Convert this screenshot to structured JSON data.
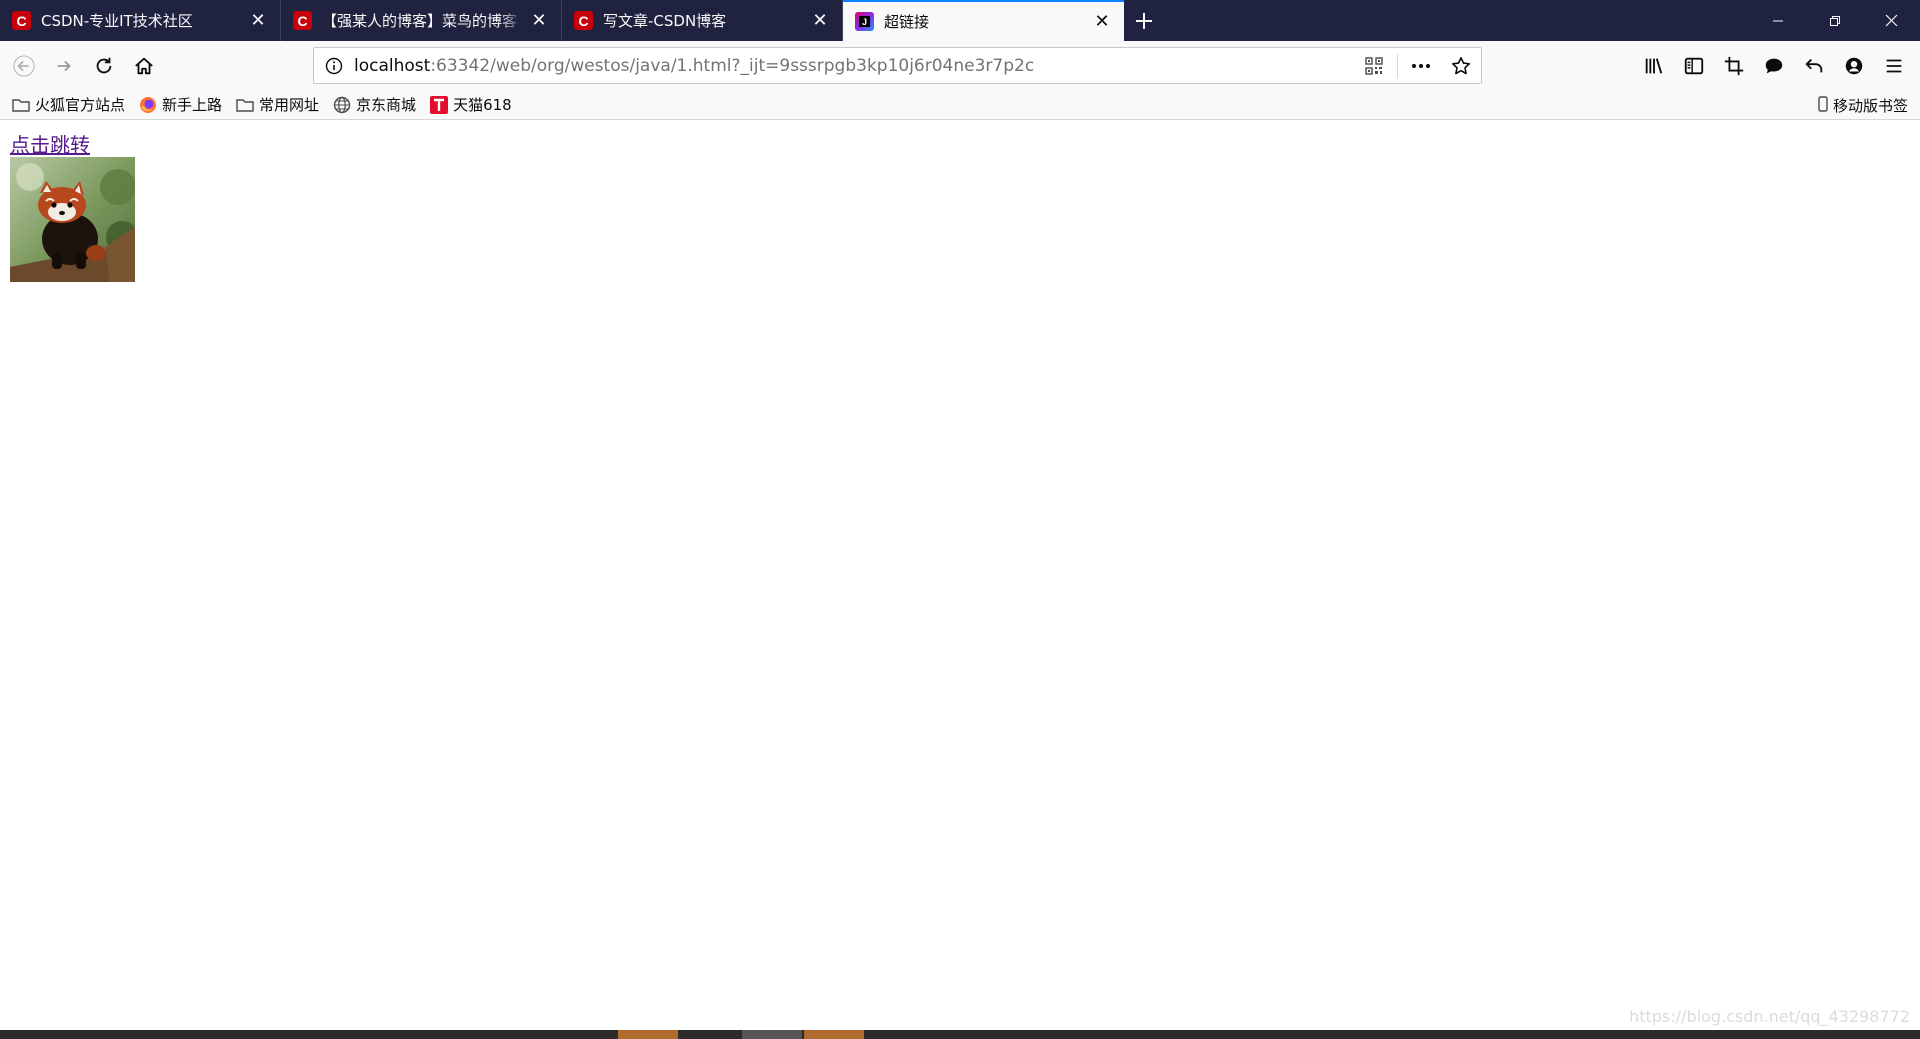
{
  "tabs": [
    {
      "title": "CSDN-专业IT技术社区",
      "favicon": "csdn-icon",
      "active": false
    },
    {
      "title": "【强某人的博客】菜鸟的博客 -",
      "favicon": "csdn-icon",
      "active": false
    },
    {
      "title": "写文章-CSDN博客",
      "favicon": "csdn-icon",
      "active": false
    },
    {
      "title": "超链接",
      "favicon": "jetbrains-icon",
      "active": true
    }
  ],
  "urlbar": {
    "host": "localhost",
    "rest": ":63342/web/org/westos/java/1.html?_ijt=9sssrpgb3kp10j6r04ne3r7p2c"
  },
  "bookmarks": [
    {
      "label": "火狐官方站点",
      "icon": "folder-icon"
    },
    {
      "label": "新手上路",
      "icon": "firefox-icon"
    },
    {
      "label": "常用网址",
      "icon": "folder-icon"
    },
    {
      "label": "京东商城",
      "icon": "globe-icon"
    },
    {
      "label": "天猫618",
      "icon": "tmall-icon"
    }
  ],
  "mobile_bookmarks": "移动版书签",
  "page": {
    "link_text": "点击跳转"
  },
  "watermark": "https://blog.csdn.net/qq_43298772",
  "colors": {
    "tabstrip": "#202340",
    "active_tab_accent": "#0a84ff",
    "visited_link": "#551a8b",
    "csdn_red": "#c7000b"
  }
}
